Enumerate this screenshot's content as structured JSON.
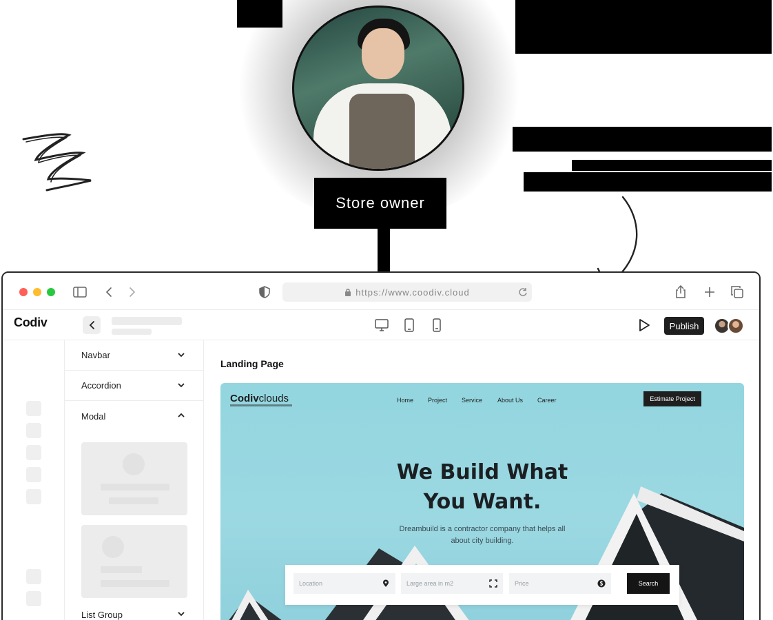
{
  "hero": {
    "tag_label": "Store owner"
  },
  "browser": {
    "url": "https://www.coodiv.cloud"
  },
  "builder": {
    "logo": "Codiv",
    "publish_label": "Publish",
    "canvas_title": "Landing Page",
    "components": [
      {
        "label": "Navbar",
        "state": "collapsed"
      },
      {
        "label": "Accordion",
        "state": "collapsed"
      },
      {
        "label": "Modal",
        "state": "expanded"
      },
      {
        "label": "List Group",
        "state": "collapsed"
      }
    ]
  },
  "preview": {
    "logo_bold": "Codiv",
    "logo_rest": "clouds",
    "nav": [
      "Home",
      "Project",
      "Service",
      "About Us",
      "Career"
    ],
    "cta": "Estimate Project",
    "headline_line1": "We Build What",
    "headline_line2": "You Want.",
    "subtitle": "Dreambuild is a contractor company that helps all about city building.",
    "search": {
      "location_placeholder": "Location",
      "area_placeholder": "Large area in m2",
      "price_placeholder": "Price",
      "button": "Search"
    }
  },
  "colors": {
    "preview_sky": "#93d6df",
    "publish_bg": "#1f1f1f",
    "traffic_red": "#ff5f57",
    "traffic_yellow": "#febc2e",
    "traffic_green": "#28c840"
  },
  "icons": [
    "sidebar-toggle-icon",
    "back-arrow-icon",
    "forward-arrow-icon",
    "shield-icon",
    "lock-icon",
    "reload-icon",
    "share-icon",
    "plus-icon",
    "tabs-icon",
    "desktop-icon",
    "tablet-icon",
    "mobile-icon",
    "play-icon",
    "chevron-down-icon",
    "chevron-up-icon",
    "location-pin-icon",
    "expand-icon",
    "dollar-icon"
  ]
}
